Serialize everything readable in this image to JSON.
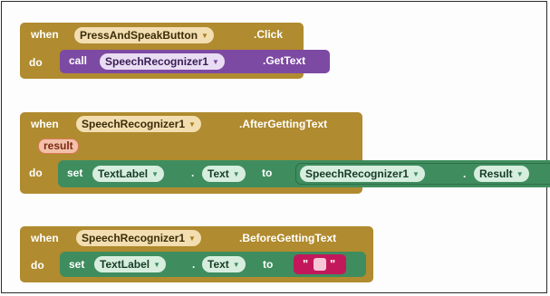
{
  "blocks": {
    "press": {
      "when": "when",
      "component": "PressAndSpeakButton",
      "event": ".Click",
      "do": "do",
      "call": "call",
      "call_component": "SpeechRecognizer1",
      "method": ".GetText"
    },
    "after": {
      "when": "when",
      "component": "SpeechRecognizer1",
      "event": ".AfterGettingText",
      "param": "result",
      "do": "do",
      "set": "set",
      "set_component": "TextLabel",
      "dot": ".",
      "property": "Text",
      "to": "to",
      "value_component": "SpeechRecognizer1",
      "value_dot": ".",
      "value_property": "Result"
    },
    "before": {
      "when": "when",
      "component": "SpeechRecognizer1",
      "event": ".BeforeGettingText",
      "do": "do",
      "set": "set",
      "set_component": "TextLabel",
      "dot": ".",
      "property": "Text",
      "to": "to",
      "text_value": "\""
    }
  },
  "colors": {
    "event": "#b08b2f",
    "procedure_call": "#7d4aa3",
    "setter": "#3f8d5e",
    "text": "#c2185b",
    "param": "#f3c1a9"
  },
  "icons": {
    "dropdown": "dropdown-arrow-icon"
  }
}
